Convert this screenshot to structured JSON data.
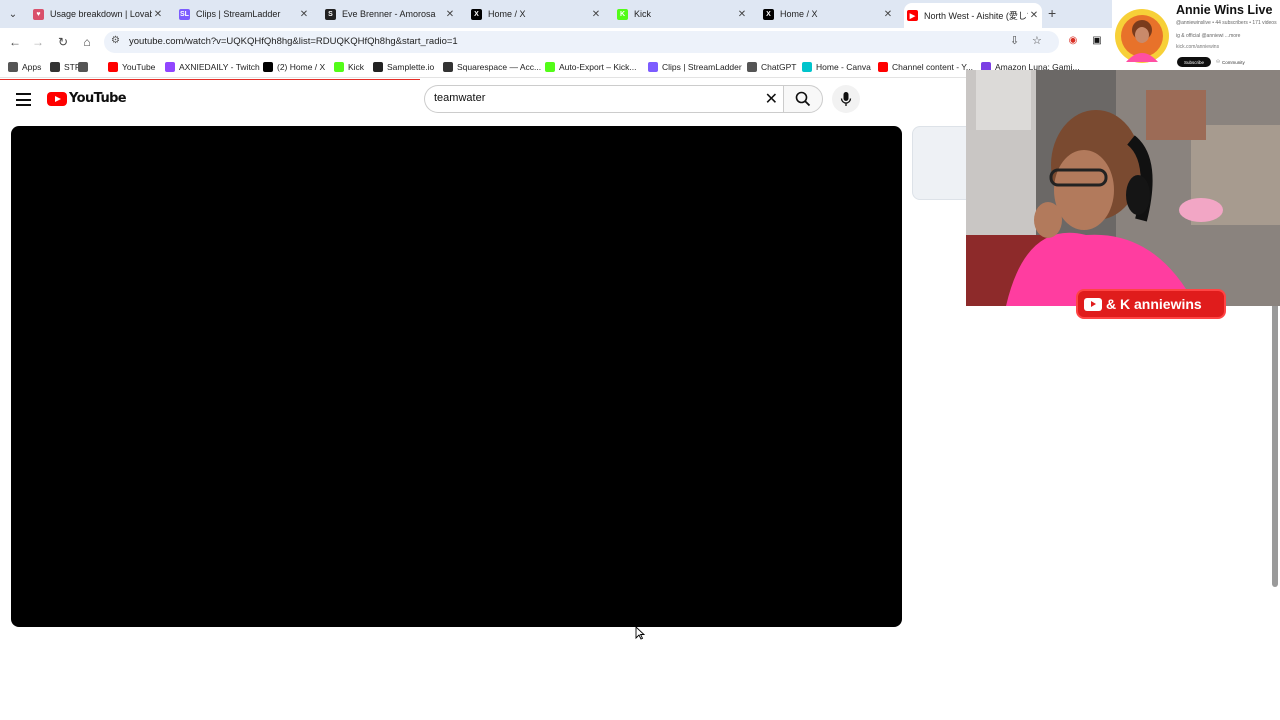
{
  "browser": {
    "tabs": [
      {
        "title": "Usage breakdown | Lovable",
        "favicon_color": "#d9506b",
        "favicon_glyph": "♥"
      },
      {
        "title": "Clips | StreamLadder",
        "favicon_color": "#7c5cff",
        "favicon_glyph": "SL"
      },
      {
        "title": "Eve Brenner - Amorosa",
        "favicon_color": "#222222",
        "favicon_glyph": "S"
      },
      {
        "title": "Home / X",
        "favicon_color": "#000000",
        "favicon_glyph": "X"
      },
      {
        "title": "Kick",
        "favicon_color": "#53fc18",
        "favicon_glyph": "K"
      },
      {
        "title": "Home / X",
        "favicon_color": "#000000",
        "favicon_glyph": "X"
      },
      {
        "title": "North West - Aishite (愛して",
        "favicon_color": "#ff0000",
        "favicon_glyph": "▶"
      }
    ],
    "active_tab_index": 6,
    "url": "youtube.com/watch?v=UQKQHfQh8hg&list=RDUQKQHfQh8hg&start_radio=1",
    "bookmarks": [
      {
        "label": "Apps",
        "icon": "grid-icon",
        "color": "#555555"
      },
      {
        "label": "STR",
        "icon": "str-icon",
        "color": "#333333"
      },
      {
        "label": "",
        "icon": "apps-icon",
        "color": "#555555"
      },
      {
        "label": "YouTube",
        "icon": "youtube-icon",
        "color": "#ff0000"
      },
      {
        "label": "AXNIEDAILY - Twitch",
        "icon": "twitch-icon",
        "color": "#9146ff"
      },
      {
        "label": "(2) Home / X",
        "icon": "x-icon",
        "color": "#000000"
      },
      {
        "label": "Kick",
        "icon": "kick-icon",
        "color": "#53fc18"
      },
      {
        "label": "Samplette.io",
        "icon": "samplette-icon",
        "color": "#222222"
      },
      {
        "label": "Squarespace — Acc...",
        "icon": "squarespace-icon",
        "color": "#333333"
      },
      {
        "label": "Auto-Export – Kick...",
        "icon": "kick-icon",
        "color": "#53fc18"
      },
      {
        "label": "Clips | StreamLadder",
        "icon": "streamladder-icon",
        "color": "#7c5cff"
      },
      {
        "label": "ChatGPT",
        "icon": "chatgpt-icon",
        "color": "#555555"
      },
      {
        "label": "Home - Canva",
        "icon": "canva-icon",
        "color": "#00c4cc"
      },
      {
        "label": "Channel content - Y...",
        "icon": "youtube-icon",
        "color": "#ff0000"
      },
      {
        "label": "Amazon Luna: Gami...",
        "icon": "luna-icon",
        "color": "#7b3fe4"
      }
    ]
  },
  "youtube": {
    "logo_text": "YouTube",
    "search_value": "teamwater",
    "search_placeholder": "Search"
  },
  "overlay": {
    "channel_name": "Annie Wins Live",
    "channel_meta": "@anniewinslive • 44 subscribers • 171 videos",
    "channel_desc": "ig & official @anniewi ...more",
    "channel_link": "kick.com/anniewins",
    "subscribe_label": "Subscribe",
    "community_label": "Community",
    "handle_tag": "& K anniewins"
  }
}
